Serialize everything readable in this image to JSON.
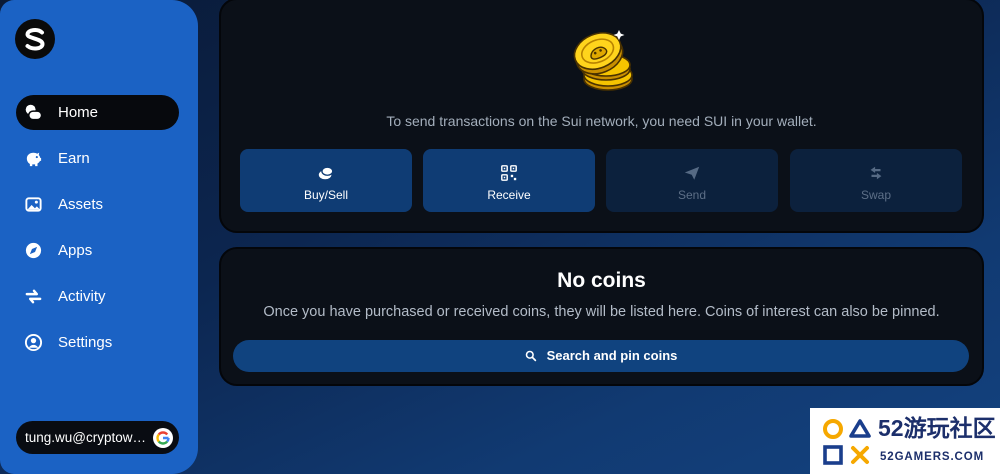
{
  "colors": {
    "sidebar": "#1b62c4",
    "panel": "#0b1018",
    "action_enabled": "#0f3c74",
    "action_disabled": "#0c213d",
    "search_button": "#10437f",
    "muted_text": "#a3aebb",
    "coin_gold": "#ffd41c"
  },
  "sidebar": {
    "logo_icon": "slush-logo-icon",
    "items": [
      {
        "label": "Home",
        "icon": "home-icon",
        "active": true
      },
      {
        "label": "Earn",
        "icon": "earn-icon",
        "active": false
      },
      {
        "label": "Assets",
        "icon": "assets-image-icon",
        "active": false
      },
      {
        "label": "Apps",
        "icon": "compass-icon",
        "active": false
      },
      {
        "label": "Activity",
        "icon": "activity-arrows-icon",
        "active": false
      },
      {
        "label": "Settings",
        "icon": "user-circle-icon",
        "active": false
      }
    ],
    "account": {
      "email": "tung.wu@cryptow…",
      "icon": "google-icon"
    }
  },
  "balance_panel": {
    "illustration": "gold-coins-icon",
    "message": "To send transactions on the Sui network, you need SUI in your wallet.",
    "actions": [
      {
        "label": "Buy/Sell",
        "icon": "coin-icon",
        "enabled": true
      },
      {
        "label": "Receive",
        "icon": "qr-code-icon",
        "enabled": true
      },
      {
        "label": "Send",
        "icon": "send-icon",
        "enabled": false
      },
      {
        "label": "Swap",
        "icon": "swap-icon",
        "enabled": false
      }
    ]
  },
  "coins_panel": {
    "title": "No coins",
    "description": "Once you have purchased or received coins, they will be listed here. Coins of interest can also be pinned.",
    "search_button": {
      "label": "Search and pin coins",
      "icon": "search-icon"
    }
  },
  "watermark": {
    "title": "52游玩社区",
    "subtitle": "52GAMERS.COM",
    "icon": "52gamers-logo-icon"
  }
}
